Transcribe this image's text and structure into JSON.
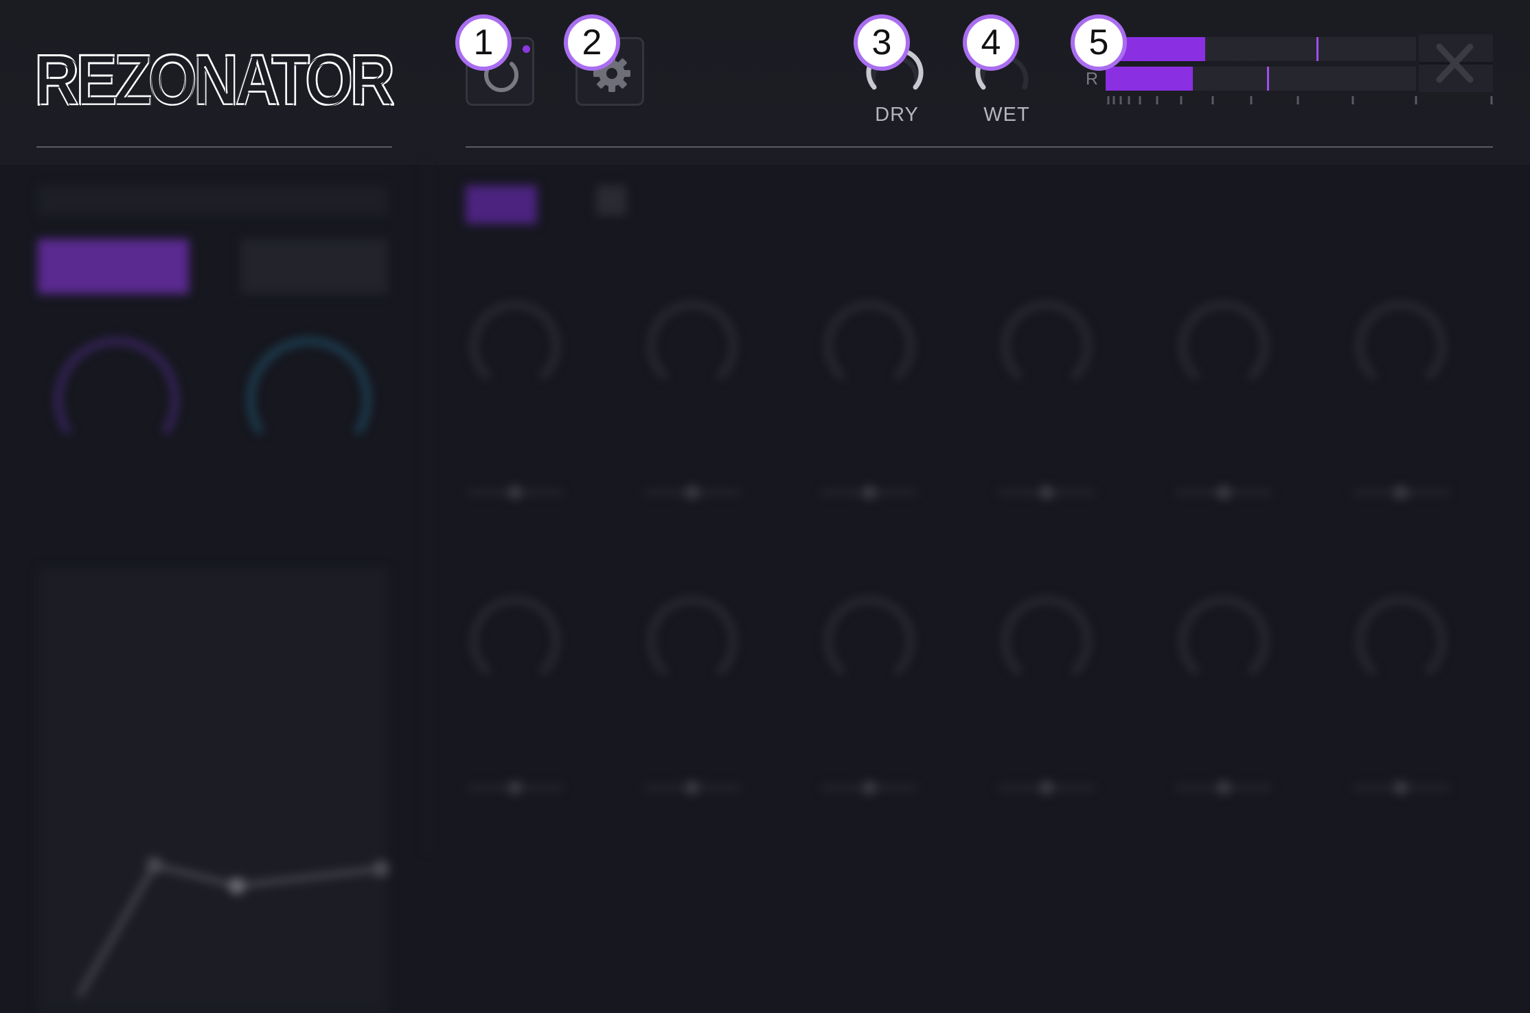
{
  "app": {
    "name": "REZONATOR"
  },
  "header": {
    "knobs": [
      {
        "id": "dry",
        "label": "DRY"
      },
      {
        "id": "wet",
        "label": "WET"
      }
    ],
    "meter": {
      "channels": [
        {
          "label": "",
          "level": 0.32,
          "peak": 0.68
        },
        {
          "label": "R",
          "level": 0.28,
          "peak": 0.52
        }
      ]
    }
  },
  "callouts": [
    "1",
    "2",
    "3",
    "4",
    "5"
  ],
  "colors": {
    "accent": "#8b2fe3",
    "callout_ring": "#a96ef0",
    "background": "#16171f"
  },
  "icons": {
    "power": "power-icon",
    "settings": "gear-icon",
    "clip": "clip-reset-icon"
  }
}
